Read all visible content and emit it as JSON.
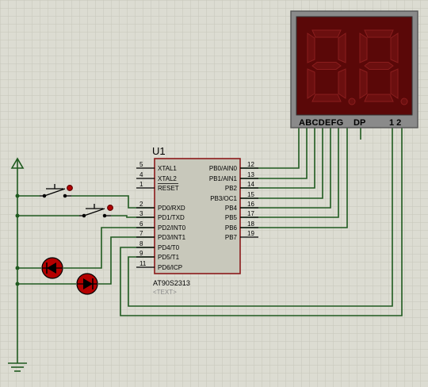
{
  "colors": {
    "background": "#dcdcd2",
    "grid": "#c8c8bd",
    "wire": "#1f5a1f",
    "chip_fill": "#c8c8bb",
    "chip_border": "#8b1a1a",
    "display_frame": "#6e6e6e",
    "segment_off": "#6b0f0f",
    "segment_bg": "#3c0000",
    "led": "#b40000",
    "text": "#000000",
    "pin_num": "#000000",
    "sub_text": "#888888"
  },
  "chip": {
    "ref": "U1",
    "part": "AT90S2313",
    "text_placeholder": "<TEXT>",
    "left_pins": [
      {
        "num": "5",
        "label": "XTAL1",
        "overline": false
      },
      {
        "num": "4",
        "label": "XTAL2",
        "overline": false
      },
      {
        "num": "1",
        "label": "RESET",
        "overline": true
      },
      {
        "num": "2",
        "label": "PD0/RXD",
        "overline": false
      },
      {
        "num": "3",
        "label": "PD1/TXD",
        "overline": false
      },
      {
        "num": "6",
        "label": "PD2/INT0",
        "overline": false
      },
      {
        "num": "7",
        "label": "PD3/INT1",
        "overline": false
      },
      {
        "num": "8",
        "label": "PD4/T0",
        "overline": false
      },
      {
        "num": "9",
        "label": "PD5/T1",
        "overline": false
      },
      {
        "num": "11",
        "label": "PD6/ICP",
        "overline": false
      }
    ],
    "right_pins": [
      {
        "num": "12",
        "label": "PB0/AIN0"
      },
      {
        "num": "13",
        "label": "PB1/AIN1"
      },
      {
        "num": "14",
        "label": "PB2"
      },
      {
        "num": "15",
        "label": "PB3/OC1"
      },
      {
        "num": "16",
        "label": "PB4"
      },
      {
        "num": "17",
        "label": "PB5"
      },
      {
        "num": "18",
        "label": "PB6"
      },
      {
        "num": "19",
        "label": "PB7"
      }
    ]
  },
  "display": {
    "segment_labels": "ABCDEFG",
    "dp_label": "DP",
    "common_labels": "1 2",
    "digits": [
      {
        "digit": "8"
      },
      {
        "digit": "8"
      }
    ]
  }
}
